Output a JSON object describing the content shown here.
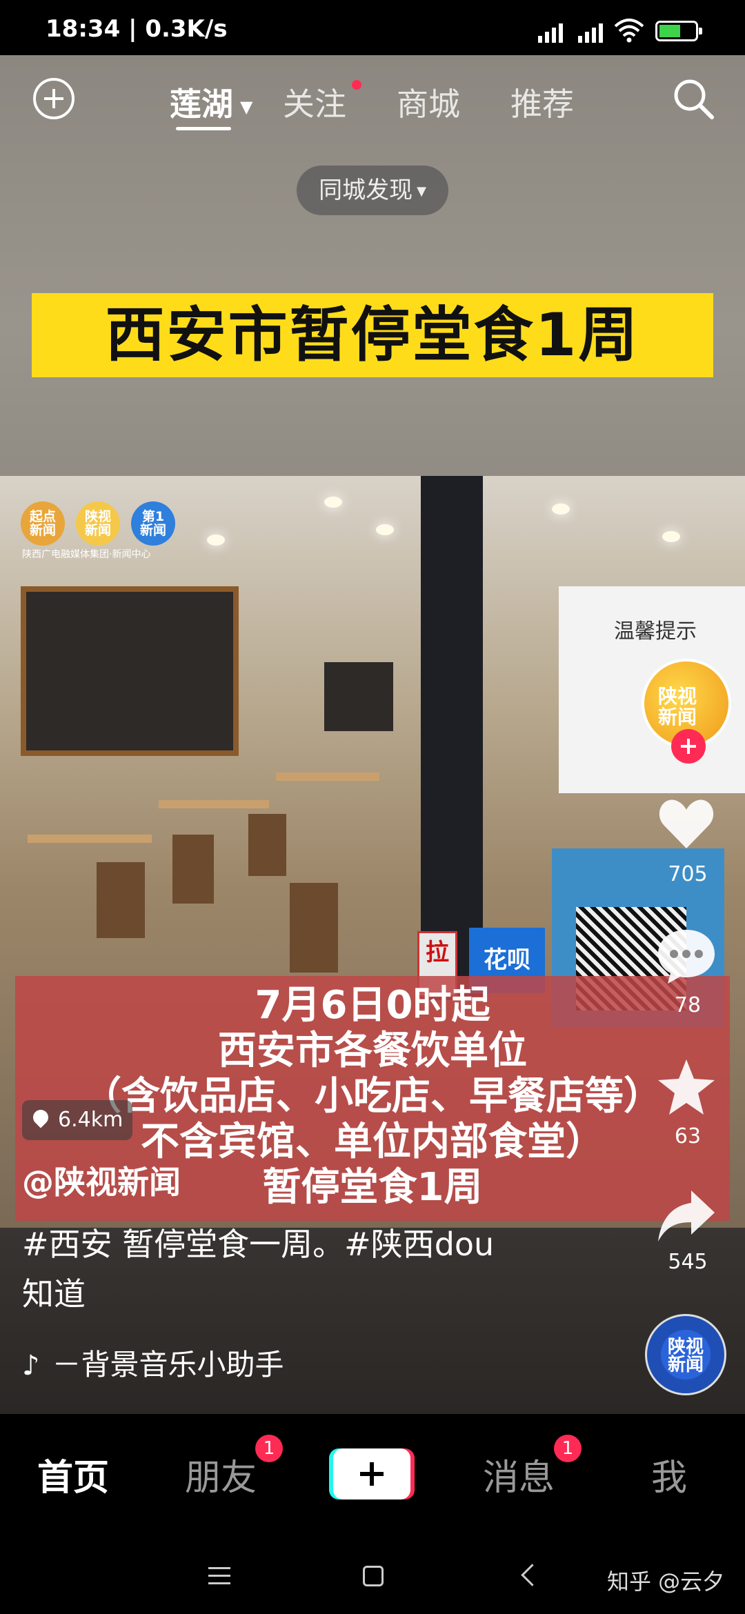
{
  "status_bar": {
    "time": "18:34 | 0.3K/s",
    "battery_level": 0.6
  },
  "top_nav": {
    "location_tab": "莲湖",
    "tabs": [
      "关注",
      "商城",
      "推荐"
    ],
    "filter_chip": "同城发现"
  },
  "video": {
    "headline": "西安市暂停堂食1周",
    "logos": [
      "起点\n新闻",
      "陕视\n新闻",
      "第1\n新闻"
    ],
    "logo_caption": "陕西广电融媒体集团·新闻中心",
    "notice_title": "温馨提示",
    "red_sign": "拉",
    "blue_sign": "花呗",
    "caption_lines": [
      "7月6日0时起",
      "西安市各餐饮单位",
      "（含饮品店、小吃店、早餐店等）",
      "不含宾馆、单位内部食堂）",
      "暂停堂食1周"
    ]
  },
  "overlay": {
    "distance": "6.4km",
    "author": "@陕视新闻",
    "description": "#西安 暂停堂食一周。#陕西dou知道",
    "music": "－背景音乐小助手",
    "avatar_text": "陕视\n新闻",
    "disc_text": "陕视\n新闻"
  },
  "sidebar": {
    "likes": "705",
    "comments": "78",
    "favorites": "63",
    "shares": "545"
  },
  "bottom_nav": {
    "home": "首页",
    "friends": "朋友",
    "friends_badge": "1",
    "messages": "消息",
    "messages_badge": "1",
    "me": "我"
  },
  "watermark": "知乎 @云夕",
  "colors": {
    "accent": "#ff2b55",
    "banner": "#ffdc1a",
    "caption_panel": "#be4646"
  }
}
